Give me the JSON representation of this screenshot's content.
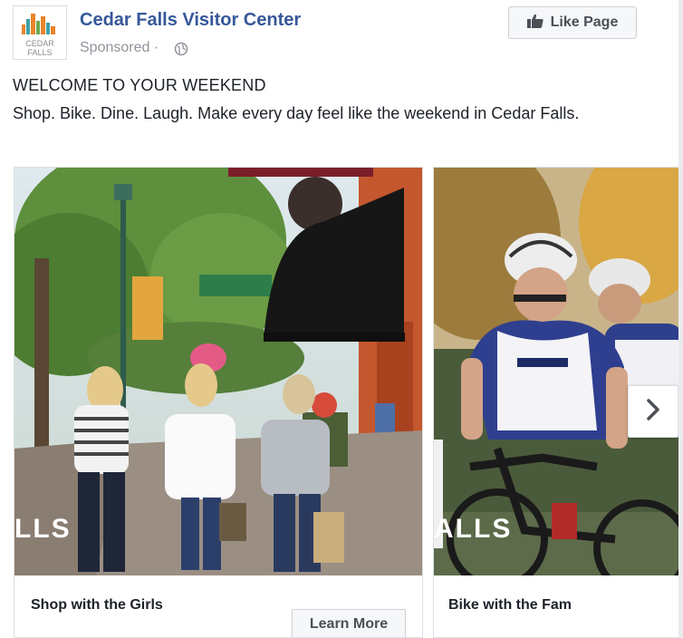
{
  "page": {
    "name": "Cedar Falls Visitor Center",
    "sponsored_label": "Sponsored",
    "sponsored_separator": "·",
    "logo_text_line1": "CEDAR",
    "logo_text_line2": "FALLS"
  },
  "like_button": {
    "label": "Like Page",
    "icon": "thumbs-up-icon"
  },
  "post": {
    "headline": "WELCOME TO YOUR WEEKEND",
    "body": "Shop. Bike. Dine. Laugh. Make every day feel like the weekend in Cedar Falls."
  },
  "carousel": {
    "cards": [
      {
        "title": "Shop with the Girls",
        "cta": "Learn More",
        "overlay_text": "LLS"
      },
      {
        "title": "Bike with the Fam",
        "overlay_text": "ALLS"
      }
    ],
    "next_icon": "chevron-right-icon"
  },
  "colors": {
    "link_blue": "#365899",
    "meta_grey": "#90949c",
    "text": "#1d2129",
    "button_bg": "#f6f7f9",
    "button_border": "#ced0d4",
    "logo_orange": "#e8842c",
    "logo_teal": "#3d9fa6"
  }
}
